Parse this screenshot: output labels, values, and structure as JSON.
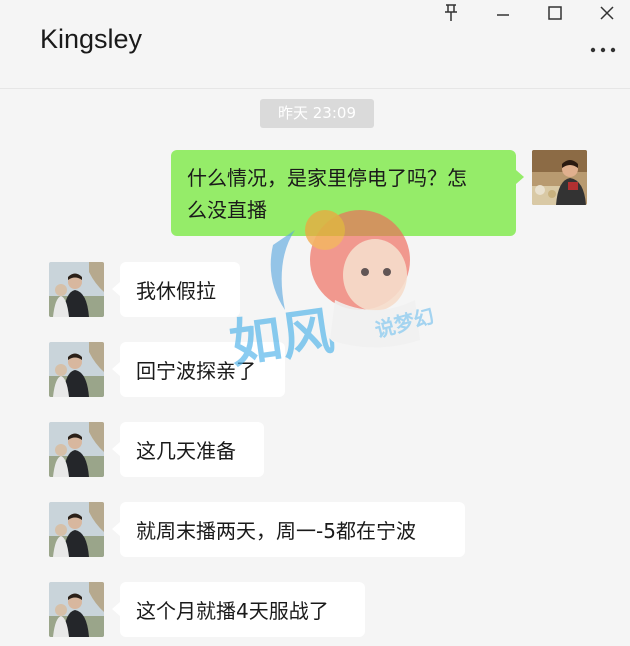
{
  "header": {
    "title": "Kingsley",
    "icons": [
      "pin-icon",
      "minimize-icon",
      "maximize-icon",
      "close-icon",
      "more-icon"
    ]
  },
  "chat": {
    "timestamp": "昨天 23:09",
    "outgoing": {
      "line1": "什么情况，是家里停电了吗？怎",
      "line2": "么没直播"
    },
    "incoming": [
      {
        "text": "我休假拉"
      },
      {
        "text": "回宁波探亲了"
      },
      {
        "text": "这几天准备"
      },
      {
        "text": "就周末播两天，周一-5都在宁波"
      },
      {
        "text": "这个月就播4天服战了"
      }
    ]
  },
  "watermark": {
    "main": "如风",
    "sub": "说梦幻"
  },
  "colors": {
    "background": "#f5f5f5",
    "outgoing_bubble": "#95ec69",
    "incoming_bubble": "#ffffff",
    "timestamp_bg": "#dadada"
  }
}
